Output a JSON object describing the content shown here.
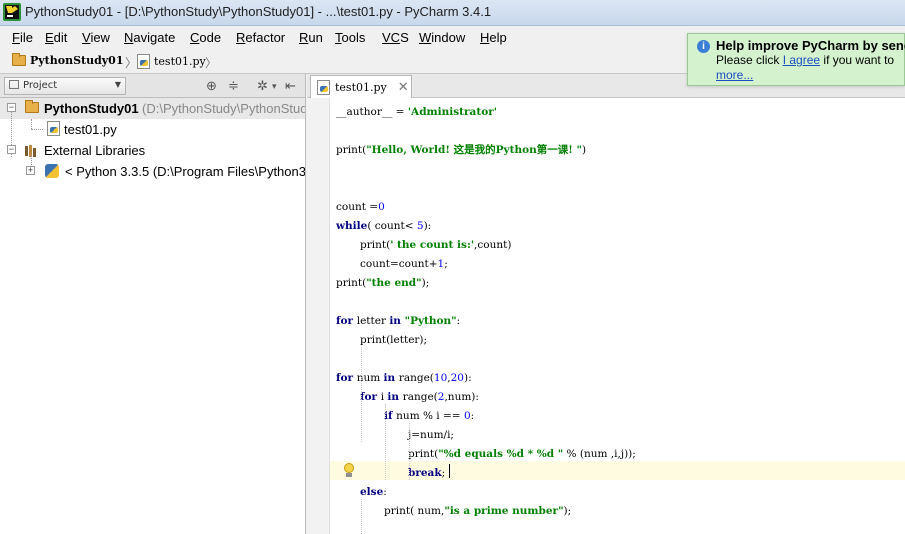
{
  "window": {
    "title": "PythonStudy01 - [D:\\PythonStudy\\PythonStudy01] - ...\\test01.py - PyCharm 3.4.1"
  },
  "menu": [
    {
      "first": "F",
      "rest": "ile"
    },
    {
      "first": "E",
      "rest": "dit"
    },
    {
      "first": "V",
      "rest": "iew"
    },
    {
      "first": "N",
      "rest": "avigate"
    },
    {
      "first": "C",
      "rest": "ode"
    },
    {
      "first": "R",
      "rest": "efactor"
    },
    {
      "first": "R",
      "rest": "un"
    },
    {
      "first": "T",
      "rest": "ools"
    },
    {
      "first": "VC",
      "rest": "S"
    },
    {
      "first": "W",
      "rest": "indow"
    },
    {
      "first": "H",
      "rest": "elp"
    }
  ],
  "breadcrumb": {
    "project": "PythonStudy01",
    "file": "test01.py"
  },
  "notification": {
    "title": "Help improve PyCharm by send",
    "text_before": "Please click ",
    "link": "I agree",
    "text_after": " if you want to",
    "more": "more..."
  },
  "project_panel": {
    "view_label": "Project",
    "root": {
      "name": "PythonStudy01",
      "path": "(D:\\PythonStudy\\PythonStud"
    },
    "file": "test01.py",
    "external": "External Libraries",
    "python": "< Python 3.3.5 (D:\\Program Files\\Python3."
  },
  "editor": {
    "tab": "test01.py",
    "lines": [
      {
        "indent": 0,
        "parts": [
          {
            "t": "__author__ = ",
            "c": "n"
          },
          {
            "t": "'Administrator'",
            "c": "s"
          }
        ]
      },
      {
        "indent": 0,
        "parts": []
      },
      {
        "indent": 0,
        "parts": [
          {
            "t": "print(",
            "c": "n"
          },
          {
            "t": "\"Hello, World! 这是我的Python第一课! \"",
            "c": "s"
          },
          {
            "t": ")",
            "c": "n"
          }
        ]
      },
      {
        "indent": 0,
        "parts": []
      },
      {
        "indent": 0,
        "parts": []
      },
      {
        "indent": 0,
        "parts": [
          {
            "t": "count =",
            "c": "n"
          },
          {
            "t": "0",
            "c": "d"
          }
        ]
      },
      {
        "indent": 0,
        "parts": [
          {
            "t": "while",
            "c": "k"
          },
          {
            "t": "( count< ",
            "c": "n"
          },
          {
            "t": "5",
            "c": "d"
          },
          {
            "t": "):",
            "c": "n"
          }
        ]
      },
      {
        "indent": 1,
        "parts": [
          {
            "t": "print(",
            "c": "n"
          },
          {
            "t": "' the count is:'",
            "c": "s"
          },
          {
            "t": ",count)",
            "c": "n"
          }
        ]
      },
      {
        "indent": 1,
        "parts": [
          {
            "t": "count=count+",
            "c": "n"
          },
          {
            "t": "1",
            "c": "d"
          },
          {
            "t": ";",
            "c": "n"
          }
        ]
      },
      {
        "indent": 0,
        "parts": [
          {
            "t": "print(",
            "c": "n"
          },
          {
            "t": "\"the end\"",
            "c": "s"
          },
          {
            "t": ");",
            "c": "n"
          }
        ]
      },
      {
        "indent": 0,
        "parts": []
      },
      {
        "indent": 0,
        "parts": [
          {
            "t": "for ",
            "c": "k"
          },
          {
            "t": "letter ",
            "c": "n"
          },
          {
            "t": "in ",
            "c": "k"
          },
          {
            "t": "\"Python\"",
            "c": "s"
          },
          {
            "t": ":",
            "c": "n"
          }
        ]
      },
      {
        "indent": 1,
        "parts": [
          {
            "t": "print(letter);",
            "c": "n"
          }
        ]
      },
      {
        "indent": 0,
        "parts": []
      },
      {
        "indent": 0,
        "parts": [
          {
            "t": "for ",
            "c": "k"
          },
          {
            "t": "num ",
            "c": "n"
          },
          {
            "t": "in ",
            "c": "k"
          },
          {
            "t": "range(",
            "c": "n"
          },
          {
            "t": "10",
            "c": "d"
          },
          {
            "t": ",",
            "c": "n"
          },
          {
            "t": "20",
            "c": "d"
          },
          {
            "t": "):",
            "c": "n"
          }
        ]
      },
      {
        "indent": 1,
        "parts": [
          {
            "t": "for ",
            "c": "k"
          },
          {
            "t": "i ",
            "c": "n"
          },
          {
            "t": "in ",
            "c": "k"
          },
          {
            "t": "range(",
            "c": "n"
          },
          {
            "t": "2",
            "c": "d"
          },
          {
            "t": ",num):",
            "c": "n"
          }
        ]
      },
      {
        "indent": 2,
        "parts": [
          {
            "t": "if ",
            "c": "k"
          },
          {
            "t": "num % i == ",
            "c": "n"
          },
          {
            "t": "0",
            "c": "d"
          },
          {
            "t": ":",
            "c": "n"
          }
        ]
      },
      {
        "indent": 3,
        "parts": [
          {
            "t": "j=num/i;",
            "c": "n"
          }
        ]
      },
      {
        "indent": 3,
        "parts": [
          {
            "t": "print(",
            "c": "n"
          },
          {
            "t": "\"%d equals %d * %d \"",
            "c": "s"
          },
          {
            "t": " % (num ,i,j));",
            "c": "n"
          }
        ]
      },
      {
        "indent": 3,
        "parts": [
          {
            "t": "break",
            "c": "k"
          },
          {
            "t": ";",
            "c": "n"
          }
        ]
      },
      {
        "indent": 1,
        "parts": [
          {
            "t": "else",
            "c": "k"
          },
          {
            "t": ":",
            "c": "n"
          }
        ]
      },
      {
        "indent": 2,
        "parts": [
          {
            "t": "print( num,",
            "c": "n"
          },
          {
            "t": "\"is a prime number\"",
            "c": "s"
          },
          {
            "t": ");",
            "c": "n"
          }
        ]
      }
    ]
  }
}
